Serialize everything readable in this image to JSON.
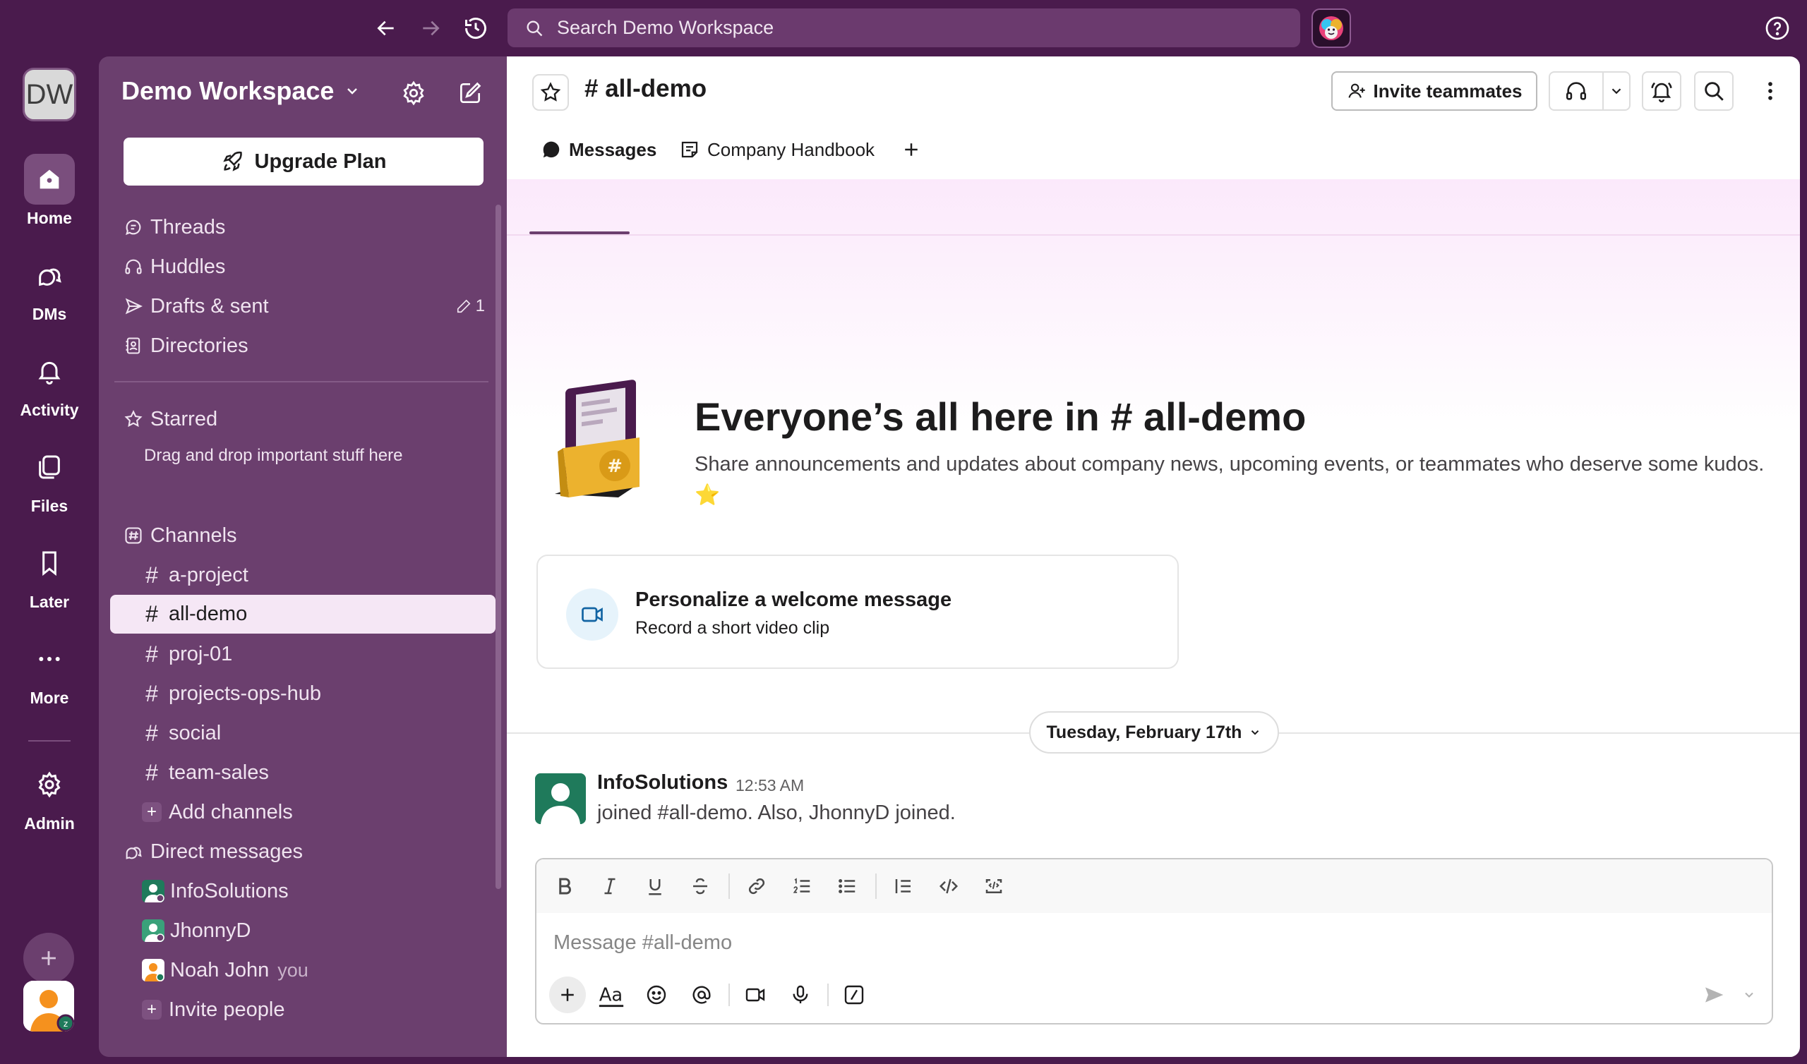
{
  "colors": {
    "aubergine": "#4a1b4d",
    "sidebar": "#6b3f6e",
    "active_channel": "#f5e7f5",
    "accent_green": "#1f7a5b"
  },
  "topbar": {
    "back_icon": "arrow-left-icon",
    "forward_icon": "arrow-right-icon",
    "history_icon": "history-icon",
    "search_placeholder": "Search Demo Workspace",
    "help_icon": "help-circle-icon"
  },
  "rail": {
    "workspace_initials": "DW",
    "items": [
      {
        "label": "Home",
        "icon": "home-icon"
      },
      {
        "label": "DMs",
        "icon": "dms-icon"
      },
      {
        "label": "Activity",
        "icon": "bell-icon"
      },
      {
        "label": "Files",
        "icon": "files-icon"
      },
      {
        "label": "Later",
        "icon": "bookmark-icon"
      },
      {
        "label": "More",
        "icon": "more-icon"
      },
      {
        "label": "Admin",
        "icon": "gear-icon"
      }
    ]
  },
  "sidebar": {
    "workspace_name": "Demo Workspace",
    "upgrade_label": "Upgrade Plan",
    "nav": [
      {
        "label": "Threads"
      },
      {
        "label": "Huddles"
      },
      {
        "label": "Drafts & sent",
        "count": "1"
      },
      {
        "label": "Directories"
      }
    ],
    "starred_label": "Starred",
    "starred_hint": "Drag and drop important stuff here",
    "channels_label": "Channels",
    "channels": [
      "a-project",
      "all-demo",
      "proj-01",
      "projects-ops-hub",
      "social",
      "team-sales"
    ],
    "active_channel": "all-demo",
    "add_channels_label": "Add channels",
    "dms_label": "Direct messages",
    "dms": [
      {
        "name": "InfoSolutions",
        "tag": ""
      },
      {
        "name": "JhonnyD",
        "tag": ""
      },
      {
        "name": "Noah John",
        "tag": "you"
      }
    ],
    "invite_people_label": "Invite people"
  },
  "header": {
    "channel_name": "# all-demo",
    "invite_label": "Invite teammates",
    "tabs": [
      {
        "label": "Messages"
      },
      {
        "label": "Company Handbook"
      }
    ]
  },
  "intro": {
    "title": "Everyone’s all here in # all-demo",
    "description": "Share announcements and updates about company news, upcoming events, or teammates who deserve some kudos. ⭐"
  },
  "welcome_card": {
    "title": "Personalize a welcome message",
    "subtitle": "Record a short video clip"
  },
  "date_divider": "Tuesday, February 17th",
  "message": {
    "author": "InfoSolutions",
    "time": "12:53 AM",
    "text": "joined #all-demo. Also, JhonnyD joined."
  },
  "composer": {
    "placeholder": "Message #all-demo"
  }
}
